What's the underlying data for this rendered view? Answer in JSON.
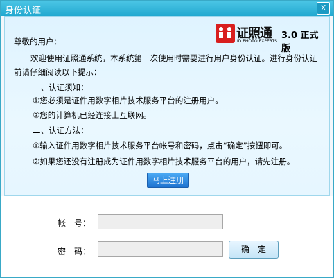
{
  "window": {
    "title": "身份认证",
    "close_glyph": "X"
  },
  "content": {
    "greeting": "尊敬的用户：",
    "intro": "欢迎使用证照通系统，本系统第一次使用时需要进行用户身份认证。进行身份认证前请仔细阅读以下提示：",
    "section1_title": "一、认证须知：",
    "notice1": "①您必须是证件用数字相片技术服务平台的注册用户。",
    "notice2": "②您的计算机已经连接上互联网。",
    "section2_title": "二、认证方法：",
    "method1": "①输入证件用数字相片技术服务平台帐号和密码，点击“确定”按钮即可。",
    "method2": "②如果您还没有注册成为证件用数字相片技术服务平台的用户，请先注册。",
    "register_button": "马上注册"
  },
  "logo": {
    "main": "证照通",
    "sub": "ID PHOTO EXPERTS",
    "version": "3.0 正式版"
  },
  "form": {
    "account_label": "帐　号：",
    "password_label": "密　码：",
    "account_value": "",
    "password_value": "",
    "ok_button": "确　定"
  },
  "colors": {
    "titlebar": "#21a8d0",
    "content_bg": "#e6f6ff",
    "register_button": "#1e73d0",
    "logo_red": "#d81e1e"
  }
}
